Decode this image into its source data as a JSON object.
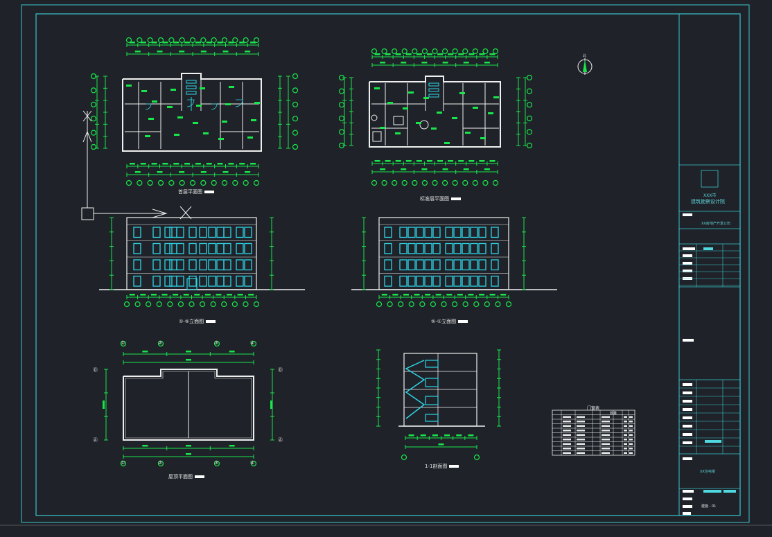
{
  "drawings": {
    "first_floor_plan": "首层平面图",
    "typical_floor_plan": "标准层平面图",
    "elevation_front": "①-⑤立面图",
    "elevation_back": "⑤-①立面图",
    "roof_plan": "屋顶平面图",
    "section": "1-1剖面图",
    "door_window_table": "门窗表",
    "table_header_group": "数量"
  },
  "title_block": {
    "institute_line1": "XXX市",
    "institute_line2": "建筑勘察设计院",
    "project": "XX房地产开发公司",
    "building": "XX住宅楼",
    "sheet_no": "建施 - 01"
  },
  "axis_labels_roof": [
    "①",
    "②",
    "③",
    "④"
  ],
  "axis_labels_side": [
    "Ⓐ",
    "Ⓑ",
    "Ⓒ",
    "Ⓓ"
  ],
  "colors": {
    "background": "#1f2329",
    "frame": "#39c6cf",
    "linework": "#f0f0f0",
    "dimension": "#19e64a",
    "windows": "#2fd4e6"
  }
}
